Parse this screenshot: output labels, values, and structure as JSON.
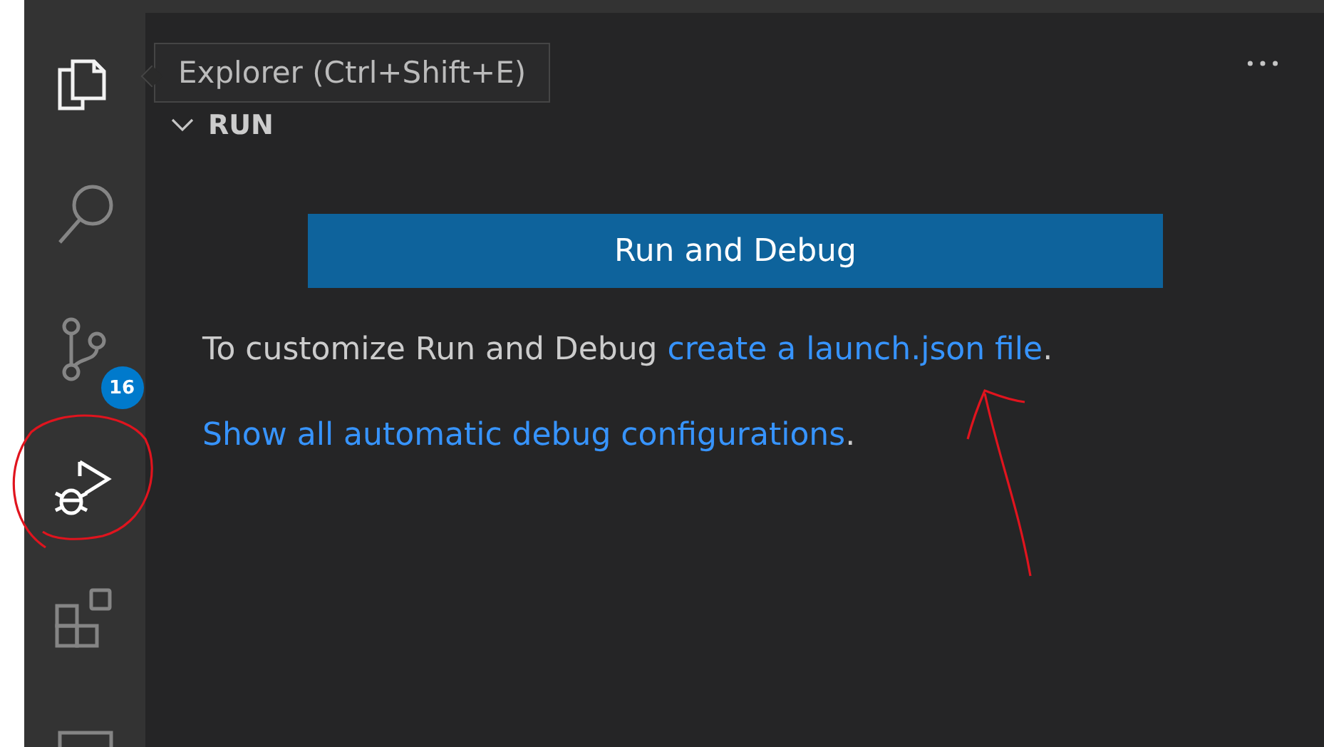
{
  "activity_bar": {
    "items": [
      {
        "kind": "files",
        "selected": false,
        "hovered": true
      },
      {
        "kind": "search",
        "selected": false
      },
      {
        "kind": "source-control",
        "selected": false,
        "badge": "16"
      },
      {
        "kind": "debug",
        "selected": true
      },
      {
        "kind": "extensions",
        "selected": false
      },
      {
        "kind": "panel",
        "selected": false
      }
    ]
  },
  "tooltip": {
    "text": "Explorer (Ctrl+Shift+E)"
  },
  "sidebar": {
    "section": {
      "title": "RUN",
      "expanded": true
    },
    "button": "Run and Debug",
    "lines": [
      {
        "text": "To customize Run and Debug ",
        "link": "create a launch.json file",
        "end": "."
      },
      {
        "link": "Show all automatic debug configurations",
        "end": "."
      }
    ]
  }
}
